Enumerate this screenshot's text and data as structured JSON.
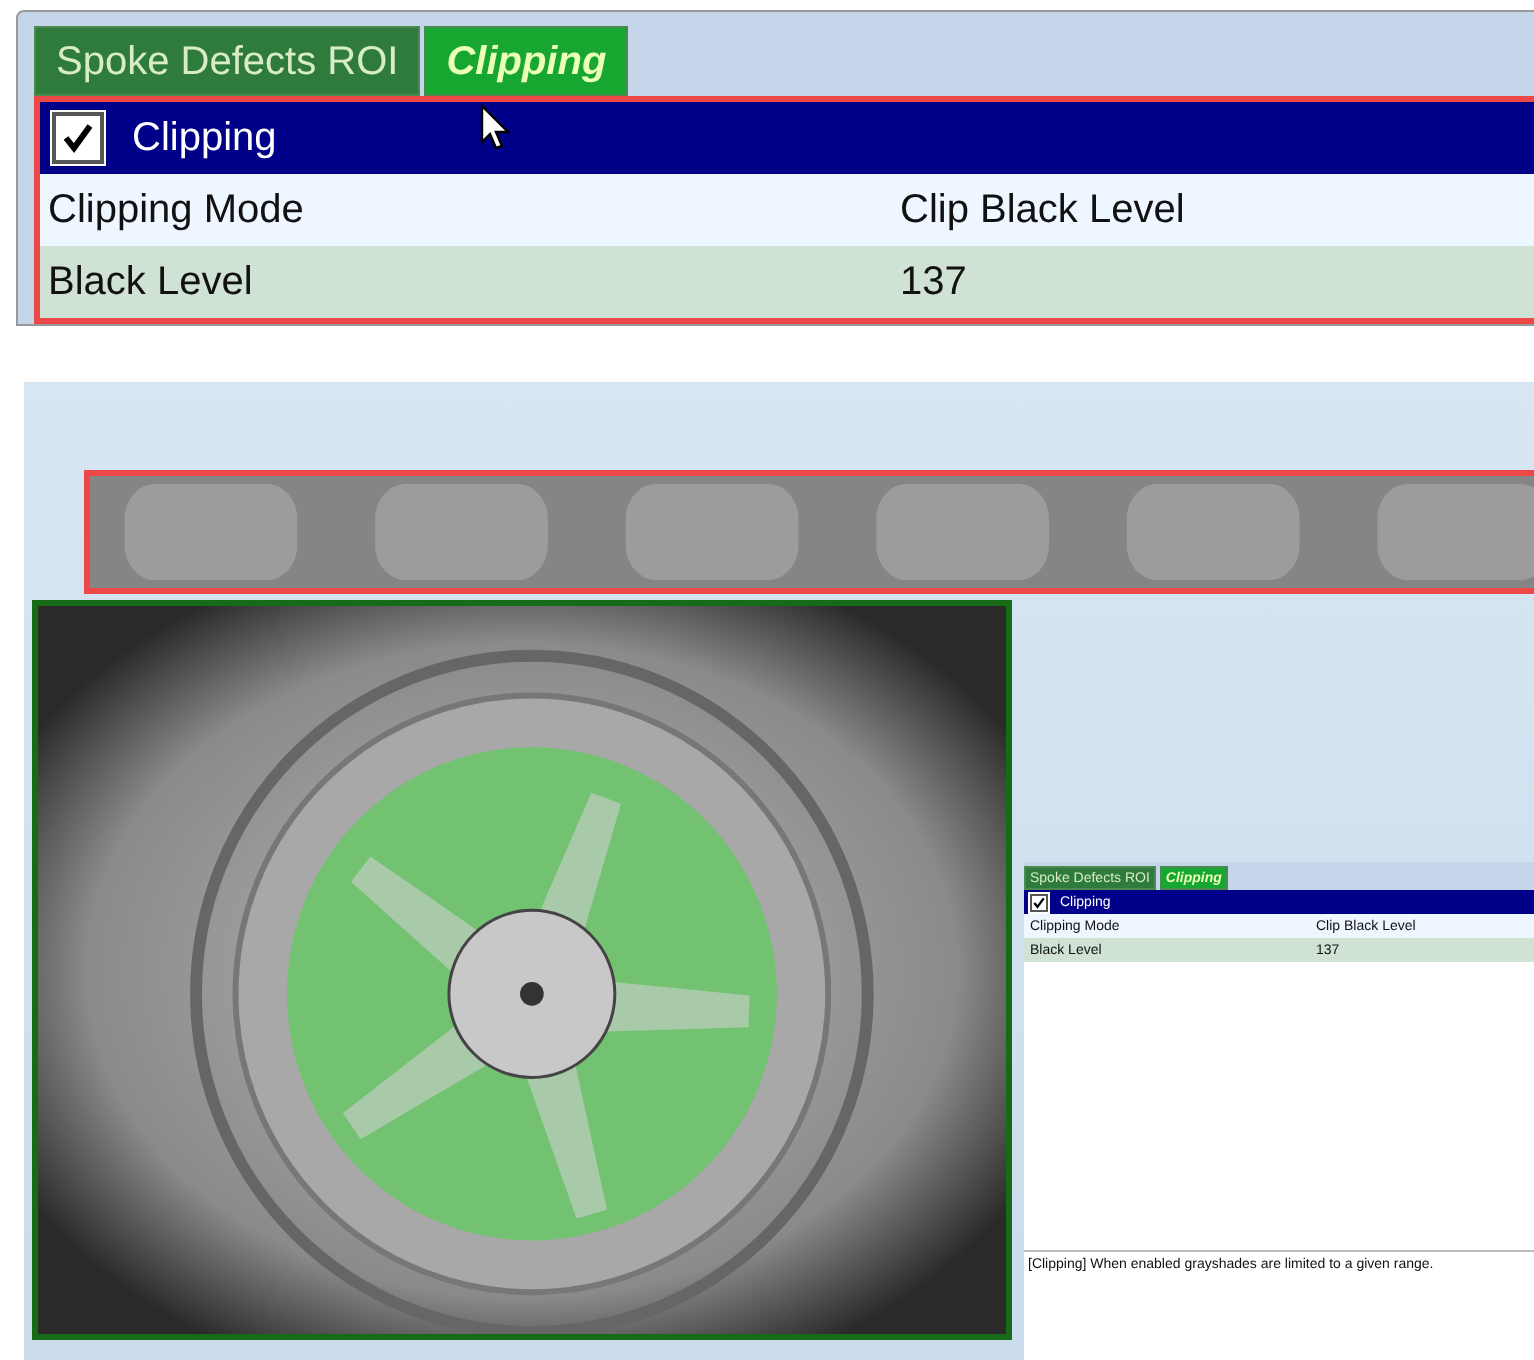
{
  "editor": {
    "tabs": [
      {
        "label": "Spoke Defects ROI",
        "selected": false
      },
      {
        "label": "Clipping",
        "selected": true
      }
    ],
    "group": {
      "label": "Clipping",
      "checked": true
    },
    "rows": [
      {
        "name": "Clipping Mode",
        "value": "Clip Black Level"
      },
      {
        "name": "Black Level",
        "value": "137"
      }
    ]
  },
  "preview": {
    "inset": {
      "tabs": [
        {
          "label": "Spoke Defects ROI",
          "selected": false
        },
        {
          "label": "Clipping",
          "selected": true
        }
      ],
      "group": {
        "label": "Clipping",
        "checked": true
      },
      "rows": [
        {
          "name": "Clipping Mode",
          "value": "Clip Black Level"
        },
        {
          "name": "Black Level",
          "value": "137"
        }
      ],
      "help_text": "[Clipping] When enabled grayshades are limited to a given range."
    }
  }
}
